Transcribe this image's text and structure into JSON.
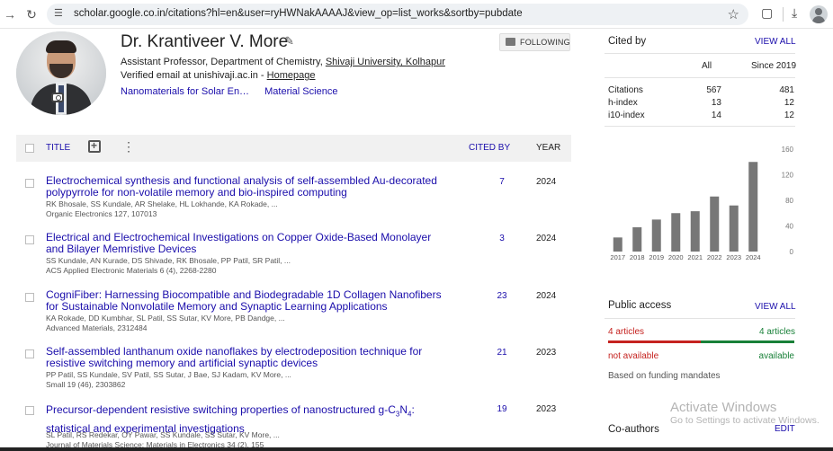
{
  "browser": {
    "url": "scholar.google.co.in/citations?hl=en&user=ryHWNakAAAAJ&view_op=list_works&sortby=pubdate"
  },
  "profile": {
    "name": "Dr. Krantiveer V. More",
    "affiliation_prefix": "Assistant Professor, Department of Chemistry, ",
    "affiliation_link": "Shivaji University, Kolhapur",
    "email_prefix": "Verified email at unishivaji.ac.in - ",
    "homepage_label": "Homepage",
    "interests": [
      "Nanomaterials for Solar En…",
      "Material Science"
    ],
    "follow_label": "FOLLOWING"
  },
  "table": {
    "col_title": "TITLE",
    "col_cited": "CITED BY",
    "col_year": "YEAR",
    "rows": [
      {
        "title": "Electrochemical synthesis and functional analysis of self-assembled Au-decorated polypyrrole for non-volatile memory and bio-inspired computing",
        "authors": "RK Bhosale, SS Kundale, AR Shelake, HL Lokhande, KA Rokade, ...",
        "venue": "Organic Electronics 127, 107013",
        "cited": "7",
        "year": "2024"
      },
      {
        "title": "Electrical and Electrochemical Investigations on Copper Oxide-Based Monolayer and Bilayer Memristive Devices",
        "authors": "SS Kundale, AN Kurade, DS Shivade, RK Bhosale, PP Patil, SR Patil, ...",
        "venue": "ACS Applied Electronic Materials 6 (4), 2268-2280",
        "cited": "3",
        "year": "2024"
      },
      {
        "title": "CogniFiber: Harnessing Biocompatible and Biodegradable 1D Collagen Nanofibers for Sustainable Nonvolatile Memory and Synaptic Learning Applications",
        "authors": "KA Rokade, DD Kumbhar, SL Patil, SS Sutar, KV More, PB Dandge, ...",
        "venue": "Advanced Materials, 2312484",
        "cited": "23",
        "year": "2024"
      },
      {
        "title": "Self-assembled lanthanum oxide nanoflakes by electrodeposition technique for resistive switching memory and artificial synaptic devices",
        "authors": "PP Patil, SS Kundale, SV Patil, SS Sutar, J Bae, SJ Kadam, KV More, ...",
        "venue": "Small 19 (46), 2303862",
        "cited": "21",
        "year": "2023"
      },
      {
        "title_pre": "Precursor-dependent resistive switching properties of nanostructured g-C",
        "title_sub1": "3",
        "title_mid": "N",
        "title_sub2": "4",
        "title_post": ": statistical and experimental investigations",
        "authors": "SL Patil, RS Redekar, OY Pawar, SS Kundale, SS Sutar, KV More, ...",
        "venue": "Journal of Materials Science: Materials in Electronics 34 (2), 155",
        "cited": "19",
        "year": "2023"
      }
    ]
  },
  "cited_by": {
    "title": "Cited by",
    "view_all": "VIEW ALL",
    "col_all": "All",
    "col_since": "Since 2019",
    "metrics": [
      {
        "label": "Citations",
        "all": "567",
        "since": "481"
      },
      {
        "label": "h-index",
        "all": "13",
        "since": "12"
      },
      {
        "label": "i10-index",
        "all": "14",
        "since": "12"
      }
    ]
  },
  "chart_data": {
    "type": "bar",
    "categories": [
      "2017",
      "2018",
      "2019",
      "2020",
      "2021",
      "2022",
      "2023",
      "2024"
    ],
    "values": [
      22,
      38,
      50,
      60,
      63,
      86,
      72,
      140
    ],
    "yticks": [
      "0",
      "40",
      "80",
      "120",
      "160"
    ],
    "ylim": [
      0,
      160
    ],
    "bar_color": "#777777"
  },
  "public_access": {
    "title": "Public access",
    "view_all": "VIEW ALL",
    "left_count": "4 articles",
    "right_count": "4 articles",
    "left_label": "not available",
    "right_label": "available",
    "note": "Based on funding mandates",
    "red": "#c5221f",
    "green": "#188038"
  },
  "coauthors": {
    "title": "Co-authors",
    "edit": "EDIT"
  },
  "watermark": {
    "line1": "Activate Windows",
    "line2": "Go to Settings to activate Windows."
  }
}
